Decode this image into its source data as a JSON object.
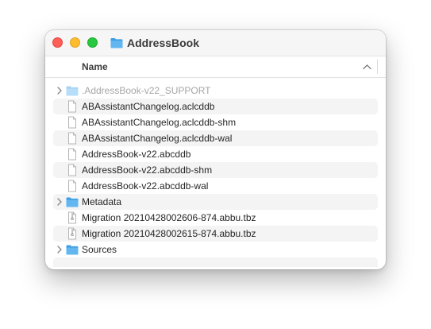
{
  "window": {
    "title": "AddressBook",
    "title_icon": "folder-icon"
  },
  "header": {
    "name_label": "Name",
    "sort_direction": "ascending",
    "sort_icon": "chevron-up-icon"
  },
  "colors": {
    "folder_blue": "#5ab4ef",
    "row_alt": "#f4f4f4",
    "close": "#ff5f57",
    "minimize": "#febc2e",
    "maximize": "#28c840"
  },
  "files": [
    {
      "label": ".AddressBook-v22_SUPPORT",
      "kind": "folder",
      "expandable": true,
      "hidden": true,
      "icon": "folder-icon"
    },
    {
      "label": "ABAssistantChangelog.aclcddb",
      "kind": "file",
      "expandable": false,
      "hidden": false,
      "icon": "document-icon"
    },
    {
      "label": "ABAssistantChangelog.aclcddb-shm",
      "kind": "file",
      "expandable": false,
      "hidden": false,
      "icon": "document-icon"
    },
    {
      "label": "ABAssistantChangelog.aclcddb-wal",
      "kind": "file",
      "expandable": false,
      "hidden": false,
      "icon": "document-icon"
    },
    {
      "label": "AddressBook-v22.abcddb",
      "kind": "file",
      "expandable": false,
      "hidden": false,
      "icon": "document-icon"
    },
    {
      "label": "AddressBook-v22.abcddb-shm",
      "kind": "file",
      "expandable": false,
      "hidden": false,
      "icon": "document-icon"
    },
    {
      "label": "AddressBook-v22.abcddb-wal",
      "kind": "file",
      "expandable": false,
      "hidden": false,
      "icon": "document-icon"
    },
    {
      "label": "Metadata",
      "kind": "folder",
      "expandable": true,
      "hidden": false,
      "icon": "folder-icon"
    },
    {
      "label": "Migration 20210428002606-874.abbu.tbz",
      "kind": "archive",
      "expandable": false,
      "hidden": false,
      "icon": "archive-icon"
    },
    {
      "label": "Migration 20210428002615-874.abbu.tbz",
      "kind": "archive",
      "expandable": false,
      "hidden": false,
      "icon": "archive-icon"
    },
    {
      "label": "Sources",
      "kind": "folder",
      "expandable": true,
      "hidden": false,
      "icon": "folder-icon"
    }
  ]
}
